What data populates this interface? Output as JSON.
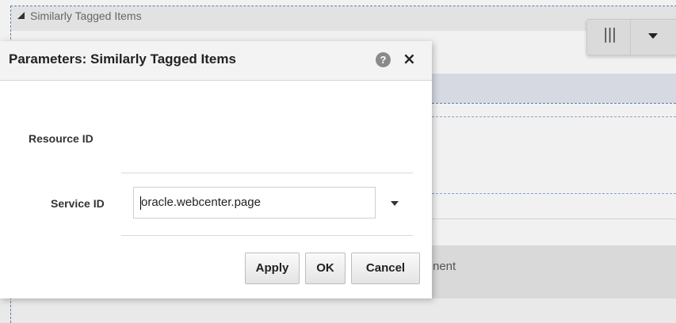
{
  "background": {
    "panel_title": "Similarly Tagged Items",
    "toolbar": {
      "columns_icon": "columns-icon",
      "menu_icon": "dropdown-arrow-icon"
    },
    "partial_text": "nent",
    "accent_color": "#5a7fb0"
  },
  "dialog": {
    "title": "Parameters: Similarly Tagged Items",
    "help_icon": "?",
    "close_icon": "×",
    "fields": {
      "resource_id": {
        "label": "Resource ID"
      },
      "service_id": {
        "label": "Service ID",
        "value": "oracle.webcenter.page"
      }
    },
    "buttons": {
      "apply": "Apply",
      "ok": "OK",
      "cancel": "Cancel"
    }
  }
}
